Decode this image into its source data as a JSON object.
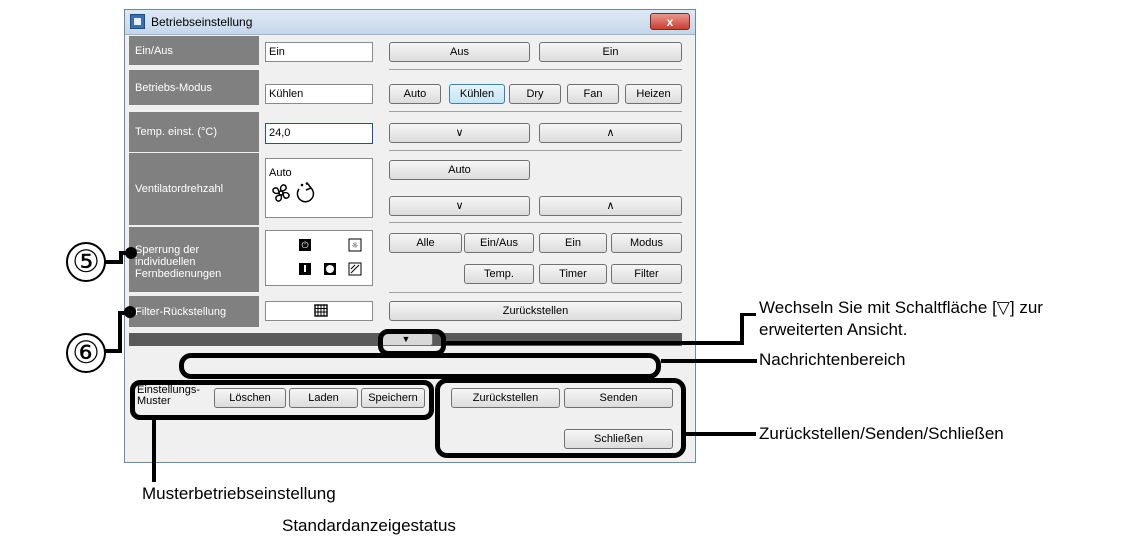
{
  "window": {
    "title": "Betriebseinstellung",
    "close_label": "x"
  },
  "rows": {
    "on_off": {
      "label": "Ein/Aus",
      "value": "Ein",
      "buttons": [
        "Aus",
        "Ein"
      ]
    },
    "mode": {
      "label": "Betriebs-Modus",
      "value": "Kühlen",
      "buttons": [
        "Auto",
        "Kühlen",
        "Dry",
        "Fan",
        "Heizen"
      ],
      "selected": "Kühlen"
    },
    "temp": {
      "label": "Temp. einst. (°C)",
      "value": "24,0",
      "down": "∨",
      "up": "∧"
    },
    "fan": {
      "label": "Ventilatordrehzahl",
      "value": "Auto",
      "auto_button": "Auto",
      "down": "∨",
      "up": "∧"
    },
    "lock": {
      "label": "Sperrung der individuellen Fernbedienungen",
      "buttons_top": [
        "Alle",
        "Ein/Aus",
        "Ein",
        "Modus"
      ],
      "buttons_bottom": [
        "Temp.",
        "Timer",
        "Filter"
      ]
    },
    "filter": {
      "label": "Filter-Rückstellung",
      "button": "Zurückstellen"
    }
  },
  "expand_arrow": "▼",
  "pattern": {
    "label": "Einstellungs-Muster",
    "buttons": [
      "Löschen",
      "Laden",
      "Speichern"
    ]
  },
  "actions": {
    "reset": "Zurückstellen",
    "send": "Senden",
    "close": "Schließen"
  },
  "annotations": {
    "num5": "⑤",
    "num6": "⑥",
    "expand_note_1": "Wechseln Sie mit Schaltfläche [▽] zur",
    "expand_note_2": "erweiterten Ansicht.",
    "message_area": "Nachrichtenbereich",
    "actions_note": "Zurückstellen/Senden/Schließen",
    "pattern_note": "Musterbetriebseinstellung",
    "default_status": "Standardanzeigestatus"
  }
}
